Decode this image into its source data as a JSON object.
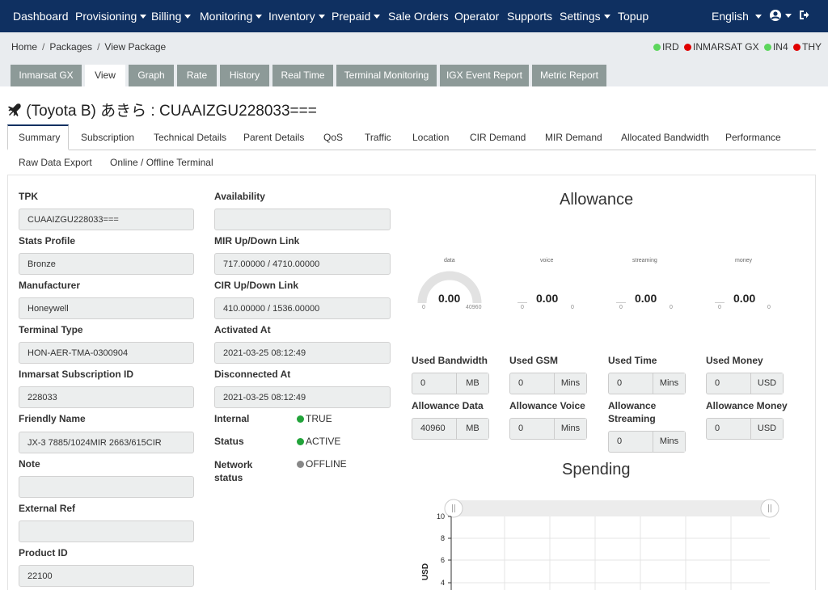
{
  "nav": {
    "items": [
      "Dashboard",
      "Provisioning",
      "Billing",
      "Monitoring",
      "Inventory",
      "Prepaid",
      "Sale Orders",
      "Operator",
      "Supports",
      "Settings",
      "Topup"
    ],
    "language": "English"
  },
  "breadcrumb": [
    "Home",
    "Packages",
    "View Package"
  ],
  "status_legend": [
    {
      "label": "IRD",
      "color": "#5cd65c"
    },
    {
      "label": "INMARSAT GX",
      "color": "#e00000"
    },
    {
      "label": "IN4",
      "color": "#5cd65c"
    },
    {
      "label": "THY",
      "color": "#e00000"
    }
  ],
  "page_tabs": [
    "Inmarsat GX",
    "View",
    "Graph",
    "Rate",
    "History",
    "Real Time",
    "Terminal Monitoring",
    "IGX Event Report",
    "Metric Report"
  ],
  "title": "(Toyota B) あきら : CUAAIZGU228033===",
  "sub_tabs": [
    "Summary",
    "Subscription",
    "Technical Details",
    "Parent Details",
    "QoS",
    "Traffic",
    "Location",
    "CIR Demand",
    "MIR Demand",
    "Allocated Bandwidth",
    "Performance",
    "Raw Data Export",
    "Online / Offline Terminal"
  ],
  "left_fields": [
    {
      "label": "TPK",
      "value": "CUAAIZGU228033==="
    },
    {
      "label": "Stats Profile",
      "value": "Bronze"
    },
    {
      "label": "Manufacturer",
      "value": "Honeywell"
    },
    {
      "label": "Terminal Type",
      "value": "HON-AER-TMA-0300904"
    },
    {
      "label": "Inmarsat Subscription ID",
      "value": "228033"
    },
    {
      "label": "Friendly Name",
      "value": "JX-3 7885/1024MIR 2663/615CIR"
    },
    {
      "label": "Note",
      "value": ""
    },
    {
      "label": "External Ref",
      "value": ""
    },
    {
      "label": "Product ID",
      "value": "22100"
    }
  ],
  "mid_fields": [
    {
      "label": "Availability",
      "value": ""
    },
    {
      "label": "MIR Up/Down Link",
      "value": "717.00000 /  4710.00000"
    },
    {
      "label": "CIR Up/Down Link",
      "value": "410.00000 / 1536.00000"
    },
    {
      "label": "Activated At",
      "value": "2021-03-25 08:12:49"
    },
    {
      "label": "Disconnected At",
      "value": "2021-03-25 08:12:49"
    }
  ],
  "status_rows": [
    {
      "label": "Internal",
      "value": "TRUE",
      "color": "#22a33a"
    },
    {
      "label": "Status",
      "value": "ACTIVE",
      "color": "#22a33a"
    },
    {
      "label": "Network status",
      "value": "OFFLINE",
      "color": "#888888"
    }
  ],
  "allowance": {
    "heading": "Allowance",
    "gauges": [
      {
        "label": "data",
        "value": "0.00",
        "min": "0",
        "max": "40960",
        "fraction": 0
      },
      {
        "label": "voice",
        "value": "0.00",
        "min": "0",
        "max": "0",
        "fraction": 0
      },
      {
        "label": "streaming",
        "value": "0.00",
        "min": "0",
        "max": "0",
        "fraction": 0
      },
      {
        "label": "money",
        "value": "0.00",
        "min": "0",
        "max": "0",
        "fraction": 0
      }
    ],
    "used": [
      {
        "label": "Used Bandwidth",
        "value": "0",
        "unit": "MB"
      },
      {
        "label": "Used GSM",
        "value": "0",
        "unit": "Mins"
      },
      {
        "label": "Used Time",
        "value": "0",
        "unit": "Mins"
      },
      {
        "label": "Used Money",
        "value": "0",
        "unit": "USD"
      }
    ],
    "limits": [
      {
        "label": "Allowance Data",
        "value": "40960",
        "unit": "MB"
      },
      {
        "label": "Allowance Voice",
        "value": "0",
        "unit": "Mins"
      },
      {
        "label": "Allowance Streaming",
        "value": "0",
        "unit": "Mins"
      },
      {
        "label": "Allowance Money",
        "value": "0",
        "unit": "USD"
      }
    ]
  },
  "spending": {
    "heading": "Spending",
    "ylabel": "USD",
    "yticks": [
      "10",
      "8",
      "6",
      "4"
    ]
  }
}
